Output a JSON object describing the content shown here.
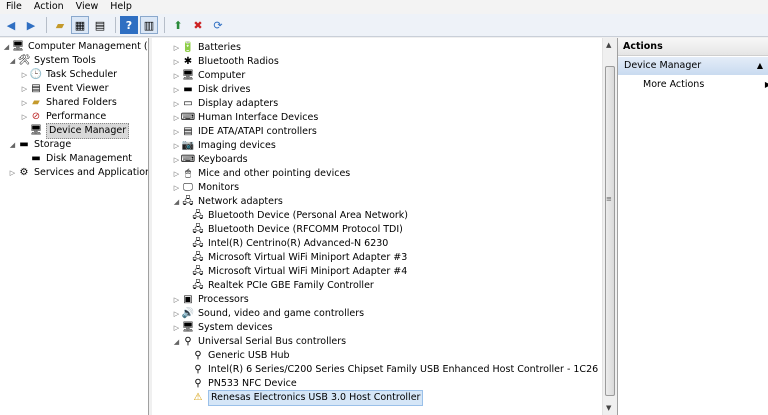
{
  "menu": [
    "File",
    "Action",
    "View",
    "Help"
  ],
  "toolbar": {
    "icons": [
      "back-arrow-icon",
      "forward-arrow-icon",
      "up-folder-icon",
      "console-tree-icon",
      "properties-icon",
      "help-icon",
      "show-hide-icon",
      "update-driver-icon",
      "uninstall-icon",
      "scan-hardware-icon"
    ]
  },
  "left_tree": {
    "root": "Computer Management (Local",
    "system_tools": "System Tools",
    "task_scheduler": "Task Scheduler",
    "event_viewer": "Event Viewer",
    "shared_folders": "Shared Folders",
    "performance": "Performance",
    "device_manager": "Device Manager",
    "storage": "Storage",
    "disk_management": "Disk Management",
    "services": "Services and Applications"
  },
  "devices": [
    {
      "label": "Batteries",
      "level": 0,
      "expanded": false,
      "icon": "battery-icon",
      "glyph": "🔋"
    },
    {
      "label": "Bluetooth Radios",
      "level": 0,
      "expanded": false,
      "icon": "bluetooth-icon",
      "glyph": "✱"
    },
    {
      "label": "Computer",
      "level": 0,
      "expanded": false,
      "icon": "computer-icon",
      "glyph": "🖥"
    },
    {
      "label": "Disk drives",
      "level": 0,
      "expanded": false,
      "icon": "disk-drive-icon",
      "glyph": "▬"
    },
    {
      "label": "Display adapters",
      "level": 0,
      "expanded": false,
      "icon": "display-adapter-icon",
      "glyph": "▭"
    },
    {
      "label": "Human Interface Devices",
      "level": 0,
      "expanded": false,
      "icon": "hid-icon",
      "glyph": "⌨"
    },
    {
      "label": "IDE ATA/ATAPI controllers",
      "level": 0,
      "expanded": false,
      "icon": "ide-controller-icon",
      "glyph": "▤"
    },
    {
      "label": "Imaging devices",
      "level": 0,
      "expanded": false,
      "icon": "camera-icon",
      "glyph": "📷"
    },
    {
      "label": "Keyboards",
      "level": 0,
      "expanded": false,
      "icon": "keyboard-icon",
      "glyph": "⌨"
    },
    {
      "label": "Mice and other pointing devices",
      "level": 0,
      "expanded": false,
      "icon": "mouse-icon",
      "glyph": "🖱"
    },
    {
      "label": "Monitors",
      "level": 0,
      "expanded": false,
      "icon": "monitor-icon",
      "glyph": "🖵"
    },
    {
      "label": "Network adapters",
      "level": 0,
      "expanded": true,
      "icon": "network-adapter-icon",
      "glyph": "🖧"
    },
    {
      "label": "Bluetooth Device (Personal Area Network)",
      "level": 1,
      "icon": "network-device-icon",
      "glyph": "🖧"
    },
    {
      "label": "Bluetooth Device (RFCOMM Protocol TDI)",
      "level": 1,
      "icon": "network-device-icon",
      "glyph": "🖧"
    },
    {
      "label": "Intel(R) Centrino(R) Advanced-N 6230",
      "level": 1,
      "icon": "network-device-icon",
      "glyph": "🖧"
    },
    {
      "label": "Microsoft Virtual WiFi Miniport Adapter #3",
      "level": 1,
      "icon": "network-device-icon",
      "glyph": "🖧"
    },
    {
      "label": "Microsoft Virtual WiFi Miniport Adapter #4",
      "level": 1,
      "icon": "network-device-icon",
      "glyph": "🖧"
    },
    {
      "label": "Realtek PCIe GBE Family Controller",
      "level": 1,
      "icon": "network-device-icon",
      "glyph": "🖧"
    },
    {
      "label": "Processors",
      "level": 0,
      "expanded": false,
      "icon": "processor-icon",
      "glyph": "▣"
    },
    {
      "label": "Sound, video and game controllers",
      "level": 0,
      "expanded": false,
      "icon": "speaker-icon",
      "glyph": "🔊"
    },
    {
      "label": "System devices",
      "level": 0,
      "expanded": false,
      "icon": "system-device-icon",
      "glyph": "🖥"
    },
    {
      "label": "Universal Serial Bus controllers",
      "level": 0,
      "expanded": true,
      "icon": "usb-icon",
      "glyph": "⚲"
    },
    {
      "label": "Generic USB Hub",
      "level": 1,
      "icon": "usb-device-icon",
      "glyph": "⚲"
    },
    {
      "label": "Intel(R) 6 Series/C200 Series Chipset Family USB Enhanced Host Controller - 1C26",
      "level": 1,
      "icon": "usb-device-icon",
      "glyph": "⚲"
    },
    {
      "label": "PN533 NFC Device",
      "level": 1,
      "icon": "usb-device-icon",
      "glyph": "⚲"
    },
    {
      "label": "Renesas Electronics USB 3.0 Host Controller",
      "level": 1,
      "icon": "usb-warning-icon",
      "glyph": "⚠",
      "selected": true
    }
  ],
  "actions": {
    "header": "Actions",
    "section": "Device Manager",
    "more": "More Actions"
  },
  "colors": {
    "selection": "#d5e6f7",
    "actions_section": "#c9dbf0"
  }
}
